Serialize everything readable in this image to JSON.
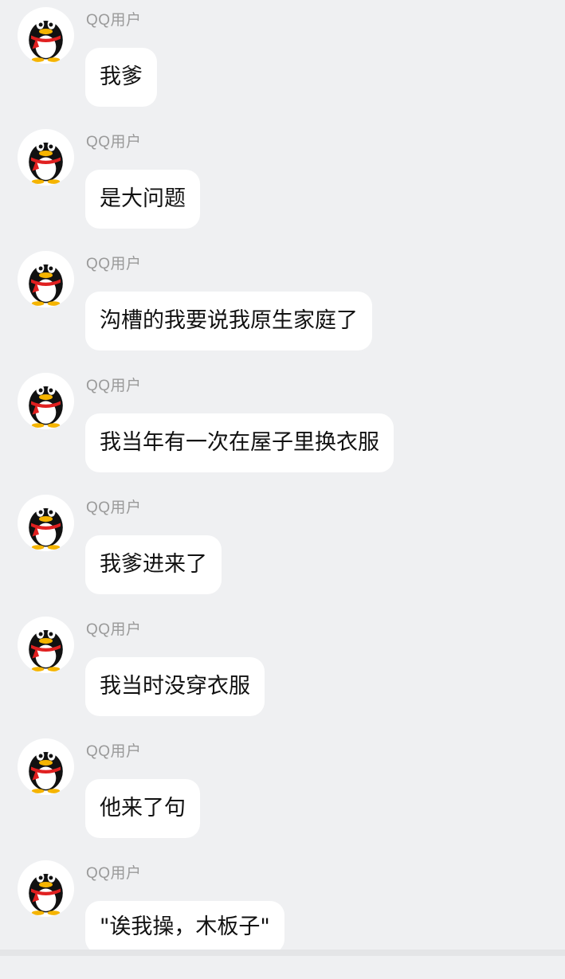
{
  "messages": [
    {
      "sender": "QQ用户",
      "text": "我爹",
      "avatar_icon": "qq-penguin-icon"
    },
    {
      "sender": "QQ用户",
      "text": "是大问题",
      "avatar_icon": "qq-penguin-icon"
    },
    {
      "sender": "QQ用户",
      "text": "沟槽的我要说我原生家庭了",
      "avatar_icon": "qq-penguin-icon"
    },
    {
      "sender": "QQ用户",
      "text": "我当年有一次在屋子里换衣服",
      "avatar_icon": "qq-penguin-icon"
    },
    {
      "sender": "QQ用户",
      "text": "我爹进来了",
      "avatar_icon": "qq-penguin-icon"
    },
    {
      "sender": "QQ用户",
      "text": "我当时没穿衣服",
      "avatar_icon": "qq-penguin-icon"
    },
    {
      "sender": "QQ用户",
      "text": "他来了句",
      "avatar_icon": "qq-penguin-icon"
    },
    {
      "sender": "QQ用户",
      "text": "\"诶我操，木板子\"",
      "avatar_icon": "qq-penguin-icon"
    }
  ],
  "colors": {
    "background": "#eff0f2",
    "bubble": "#ffffff",
    "sender_text": "#9a9a9a",
    "message_text": "#111111",
    "scarf": "#e02020"
  }
}
